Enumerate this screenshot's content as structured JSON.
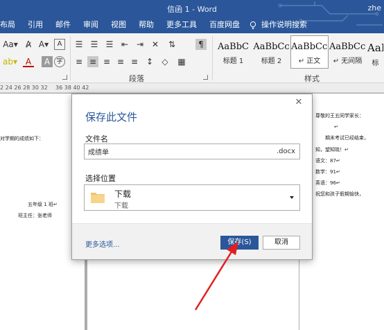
{
  "window": {
    "title": "信函 1 - Word",
    "user": "zhe"
  },
  "tabs": [
    "布局",
    "引用",
    "邮件",
    "审阅",
    "视图",
    "帮助",
    "更多工具",
    "百度网盘"
  ],
  "tell_me": "操作说明搜索",
  "ribbon": {
    "paragraph_label": "段落",
    "styles_label": "样式",
    "styles": [
      {
        "sample": "AaBbC",
        "label": "标题 1"
      },
      {
        "sample": "AaBbCc",
        "label": "标题 2"
      },
      {
        "sample": "AaBbCcI",
        "label": "↵ 正文"
      },
      {
        "sample": "AaBbCcI",
        "label": "↵ 无间隔"
      },
      {
        "sample": "AaI",
        "label": "标"
      }
    ]
  },
  "ruler": {
    "left_numbers": "2  24 26 28 30 32",
    "right_numbers": "36 38 40 42"
  },
  "document": {
    "left_lines": [
      "对学期的成绩如下：",
      "五年级 1 班↵",
      "班主任：张老师"
    ],
    "right_lines": [
      "尊敬的王五同学家长：",
      "↵",
      "   期末考试已经结束，",
      "知，望知晓！↵",
      "语文：87↵",
      "数学：91↵",
      "英语：96↵",
      "祝您和孩子假期愉快，"
    ]
  },
  "dialog": {
    "title": "保存此文件",
    "filename_label": "文件名",
    "filename_value": "成绩单",
    "extension": ".docx",
    "location_label": "选择位置",
    "location_name": "下载",
    "location_sub": "下载",
    "more_options": "更多选项...",
    "save_button": "保存(S)",
    "cancel_button": "取消"
  },
  "colors": {
    "brand": "#2b579a",
    "annotation_arrow": "#e02020"
  }
}
